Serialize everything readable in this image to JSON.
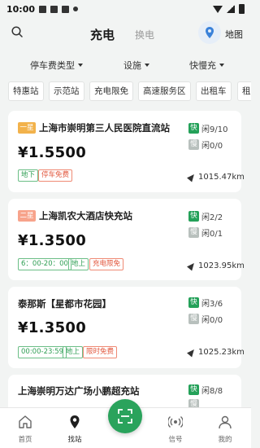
{
  "status": {
    "time": "10:00"
  },
  "header": {
    "active_tab": "充电",
    "alt_tab": "换电",
    "map_label": "地图"
  },
  "filters": [
    {
      "label": "停车费类型"
    },
    {
      "label": "设施"
    },
    {
      "label": "快慢充"
    }
  ],
  "chips": [
    "特惠站",
    "示范站",
    "充电限免",
    "高速服务区",
    "出租车",
    "租"
  ],
  "stations": [
    {
      "badge": "一星",
      "badge_color": "#f2b24b",
      "name": "上海市崇明第三人民医院直流站",
      "price": "¥1.5500",
      "tags": [
        {
          "text": "地下",
          "style": "g"
        },
        {
          "text": "停车免费",
          "style": "r"
        }
      ],
      "fast": {
        "key": "快",
        "value": "闲9/10"
      },
      "slow": {
        "key": "慢",
        "value": "闲0/0"
      },
      "distance": "1015.47km"
    },
    {
      "badge": "二星",
      "badge_color": "#f7a38b",
      "name": "上海凯农大酒店快充站",
      "price": "¥1.3500",
      "tags": [
        {
          "text": "6：00-20：00",
          "style": "g"
        },
        {
          "text": "地上",
          "style": "g"
        },
        {
          "text": "充电限免",
          "style": "r"
        }
      ],
      "fast": {
        "key": "快",
        "value": "闲2/2"
      },
      "slow": {
        "key": "慢",
        "value": "闲0/1"
      },
      "distance": "1023.95km"
    },
    {
      "badge": "",
      "badge_color": "",
      "name": "泰那斯【星都市花园】",
      "price": "¥1.3500",
      "tags": [
        {
          "text": "00:00-23:59",
          "style": "g"
        },
        {
          "text": "地上",
          "style": "g"
        },
        {
          "text": "限时免费",
          "style": "r"
        }
      ],
      "fast": {
        "key": "快",
        "value": "闲3/6"
      },
      "slow": {
        "key": "慢",
        "value": "闲0/0"
      },
      "distance": "1025.23km"
    },
    {
      "badge": "",
      "badge_color": "",
      "name": "上海崇明万达广场小鹏超充站",
      "price": "",
      "tags": [],
      "fast": {
        "key": "快",
        "value": "闲8/8"
      },
      "slow": {
        "key": "慢",
        "value": ""
      },
      "distance": ""
    }
  ],
  "bottom_nav": [
    {
      "label": "首页",
      "icon": "home-icon"
    },
    {
      "label": "找站",
      "icon": "location-pin-icon"
    },
    {
      "label": "scan",
      "icon": "scan-icon"
    },
    {
      "label": "信号",
      "icon": "signal-icon"
    },
    {
      "label": "我的",
      "icon": "user-icon"
    }
  ],
  "colors": {
    "accent": "#2aa35c",
    "tag_red": "#e2573d",
    "badge_one": "#f2b24b",
    "badge_two": "#f7a38b"
  }
}
